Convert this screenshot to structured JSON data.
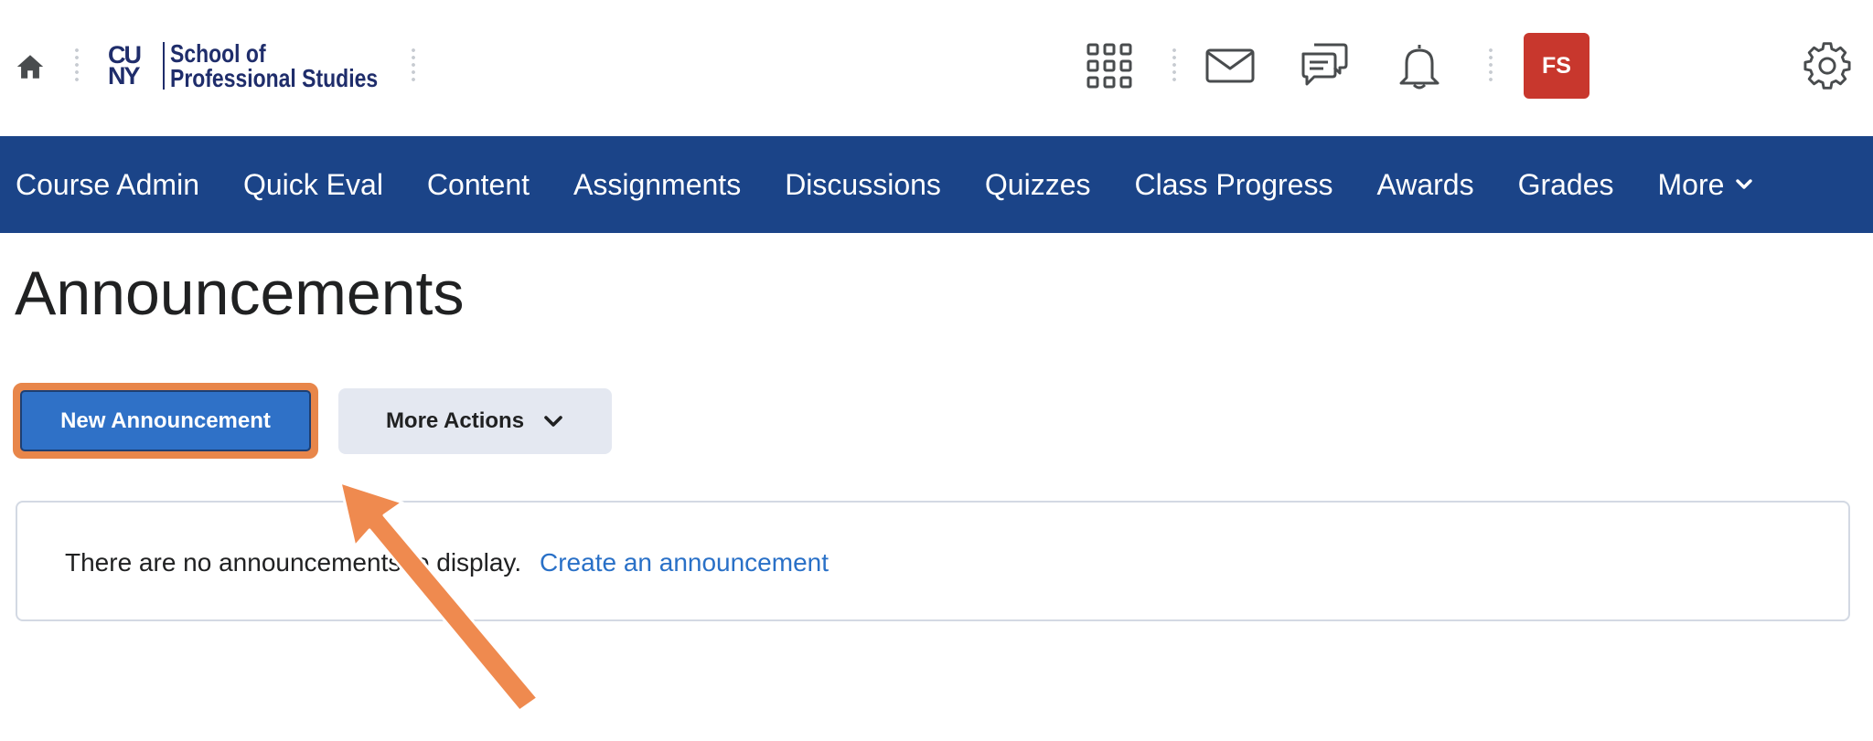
{
  "header": {
    "logo": {
      "mark": "CU NY",
      "text_line1": "School of",
      "text_line2": "Professional Studies"
    },
    "icons": [
      "home-icon",
      "waffle-icon",
      "mail-icon",
      "chat-icon",
      "bell-icon",
      "gear-icon"
    ],
    "avatar_initials": "FS"
  },
  "nav": {
    "items": [
      {
        "label": "Course Admin"
      },
      {
        "label": "Quick Eval"
      },
      {
        "label": "Content"
      },
      {
        "label": "Assignments"
      },
      {
        "label": "Discussions"
      },
      {
        "label": "Quizzes"
      },
      {
        "label": "Class Progress"
      },
      {
        "label": "Awards"
      },
      {
        "label": "Grades"
      },
      {
        "label": "More"
      }
    ]
  },
  "page": {
    "title": "Announcements",
    "new_button": "New Announcement",
    "more_actions_button": "More Actions",
    "empty_message": "There are no announcements to display.",
    "create_link": "Create an announcement"
  },
  "colors": {
    "nav_background": "#1b4488",
    "primary_button": "#2f71c7",
    "highlight": "#e8864a",
    "avatar": "#c8372d",
    "link": "#2970c7"
  }
}
